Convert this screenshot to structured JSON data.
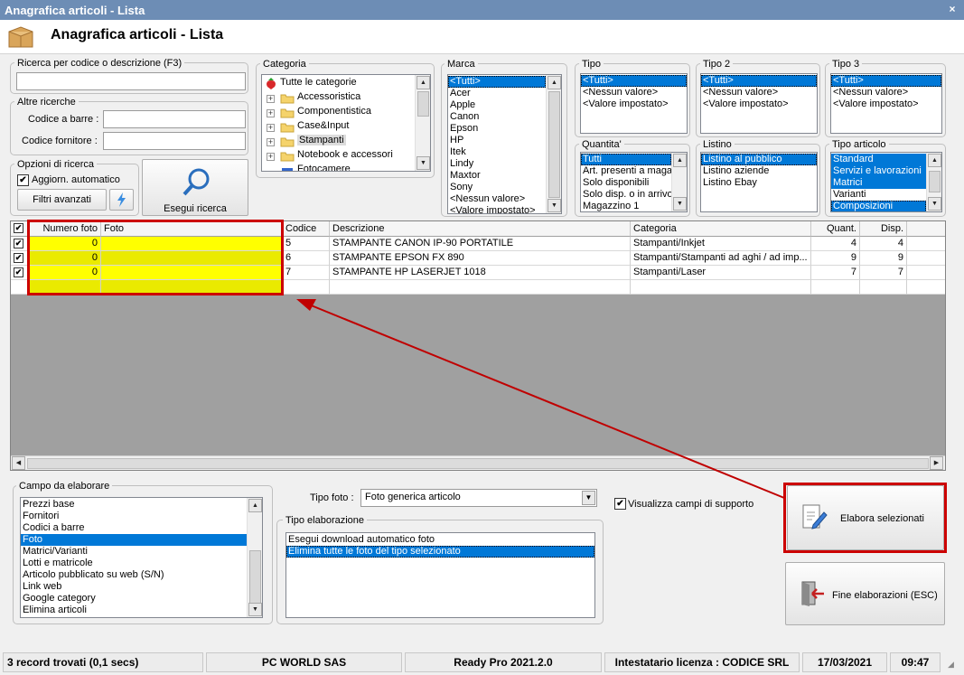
{
  "window": {
    "title": "Anagrafica articoli  - Lista",
    "close": "×"
  },
  "header": {
    "title": "Anagrafica articoli  - Lista"
  },
  "search": {
    "group_label": "Ricerca per codice o descrizione (F3)",
    "value": "",
    "other_label": "Altre ricerche",
    "barcode_label": "Codice a barre :",
    "barcode_value": "",
    "supplier_label": "Codice fornitore :",
    "supplier_value": ""
  },
  "options": {
    "group_label": "Opzioni di ricerca",
    "auto_update_label": "Aggiorn. automatico",
    "auto_update_checked": true,
    "advanced_filters_label": "Filtri avanzati",
    "run_search_label": "Esegui ricerca"
  },
  "categoria": {
    "label": "Categoria",
    "items": [
      "Tutte le categorie",
      "Accessoristica",
      "Componentistica",
      "Case&Input",
      "Stampanti",
      "Notebook e accessori",
      "Fotocamere"
    ]
  },
  "marca": {
    "label": "Marca",
    "items": [
      "<Tutti>",
      "Acer",
      "Apple",
      "Canon",
      "Epson",
      "HP",
      "Itek",
      "Lindy",
      "Maxtor",
      "Sony",
      "<Nessun valore>",
      "<Valore impostato>"
    ]
  },
  "tipo": {
    "label": "Tipo",
    "items": [
      "<Tutti>",
      "<Nessun valore>",
      "<Valore impostato>"
    ]
  },
  "tipo2": {
    "label": "Tipo 2",
    "items": [
      "<Tutti>",
      "<Nessun valore>",
      "<Valore impostato>"
    ]
  },
  "tipo3": {
    "label": "Tipo 3",
    "items": [
      "<Tutti>",
      "<Nessun valore>",
      "<Valore impostato>"
    ]
  },
  "quantita": {
    "label": "Quantita'",
    "items": [
      "Tutti",
      "Art. presenti a magazzino",
      "Solo disponibili",
      "Solo disp. o in arrivo",
      "Magazzino 1"
    ]
  },
  "listino": {
    "label": "Listino",
    "items": [
      "Listino al pubblico",
      "Listino aziende",
      "Listino Ebay"
    ]
  },
  "tipo_articolo": {
    "label": "Tipo articolo",
    "items": [
      "Standard",
      "Servizi e lavorazioni",
      "Matrici",
      "Varianti",
      "Composizioni"
    ]
  },
  "grid": {
    "columns": [
      "Numero foto",
      "Foto",
      "Codice",
      "Descrizione",
      "Categoria",
      "Quant.",
      "Disp."
    ],
    "rows": [
      {
        "checked": true,
        "numero_foto": "0",
        "foto": "",
        "codice": "5",
        "descrizione": "STAMPANTE CANON IP-90 PORTATILE",
        "categoria": "Stampanti/Inkjet",
        "quant": "4",
        "disp": "4"
      },
      {
        "checked": true,
        "numero_foto": "0",
        "foto": "",
        "codice": "6",
        "descrizione": "STAMPANTE EPSON FX 890",
        "categoria": "Stampanti/Stampanti ad aghi / ad imp...",
        "quant": "9",
        "disp": "9"
      },
      {
        "checked": true,
        "numero_foto": "0",
        "foto": "",
        "codice": "7",
        "descrizione": "STAMPANTE HP LASERJET 1018",
        "categoria": "Stampanti/Laser",
        "quant": "7",
        "disp": "7"
      }
    ]
  },
  "campo": {
    "label": "Campo da elaborare",
    "items": [
      "Prezzi base",
      "Fornitori",
      "Codici a barre",
      "Foto",
      "Matrici/Varianti",
      "Lotti e matricole",
      "Articolo pubblicato su web (S/N)",
      "Link web",
      "Google category",
      "Elimina articoli"
    ]
  },
  "tipo_foto": {
    "label": "Tipo foto :",
    "value": "Foto generica articolo"
  },
  "visualizza": {
    "label": "Visualizza campi di supporto",
    "checked": true
  },
  "tipo_elab": {
    "label": "Tipo elaborazione",
    "items": [
      "Esegui download automatico foto",
      "Elimina tutte le foto del tipo selezionato"
    ]
  },
  "buttons": {
    "process": "Elabora selezionati",
    "end": "Fine elaborazioni (ESC)"
  },
  "status": {
    "records": "3 record trovati (0,1 secs)",
    "company": "PC WORLD SAS",
    "version": "Ready Pro 2021.2.0",
    "license": "Intestatario licenza : CODICE SRL",
    "date": "17/03/2021",
    "time": "09:47"
  },
  "colors": {
    "highlight": "#0078d7",
    "annotation": "#cc0000",
    "yellow": "#ffff00",
    "titlebar": "#6d8db5"
  },
  "check_mark": "✔"
}
